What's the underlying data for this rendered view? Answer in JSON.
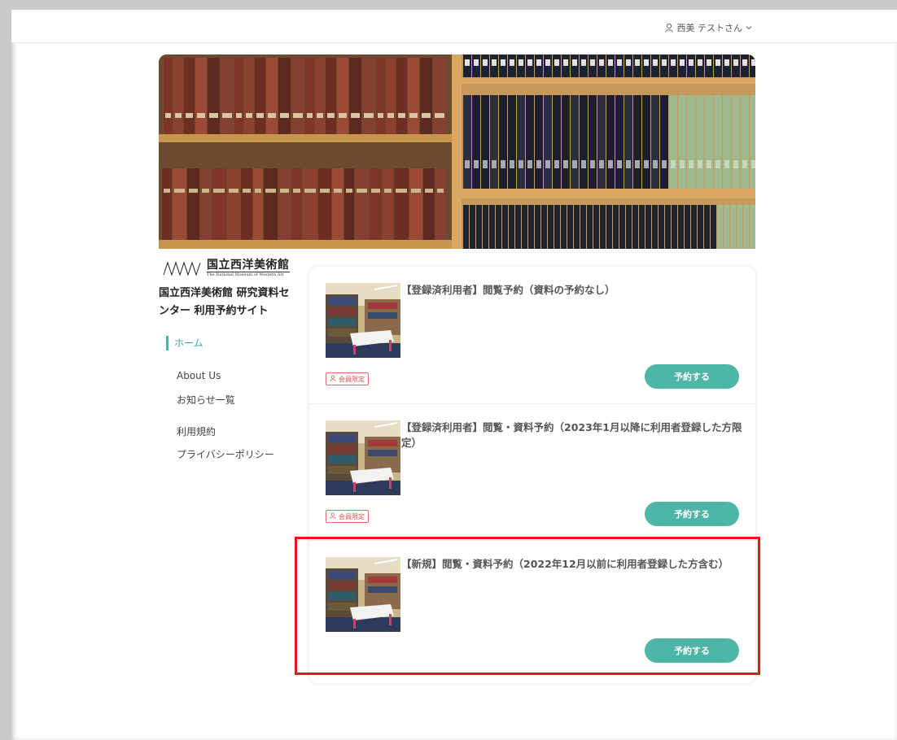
{
  "header": {
    "user_name": "西美 テストさん"
  },
  "sidebar": {
    "logo_ja": "国立西洋美術館",
    "logo_en": "The National Museum of Western Art",
    "site_title": "国立西洋美術館 研究資料センター 利用予約サイト",
    "nav": {
      "home": "ホーム",
      "about": "About Us",
      "news": "お知らせ一覧",
      "terms": "利用規約",
      "privacy": "プライバシーポリシー"
    }
  },
  "cards": [
    {
      "title": "【登録済利用者】閲覧予約（資料の予約なし）",
      "badge": "会員限定",
      "button": "予約する"
    },
    {
      "title": "【登録済利用者】閲覧・資料予約（2023年1月以降に利用者登録した方限定）",
      "badge": "会員限定",
      "button": "予約する"
    },
    {
      "title": "【新規】閲覧・資料予約（2022年12月以前に利用者登録した方含む）",
      "button": "予約する"
    }
  ],
  "colors": {
    "accent": "#4db6a6",
    "badge_red": "#d9534f",
    "highlight": "#e8151b"
  }
}
